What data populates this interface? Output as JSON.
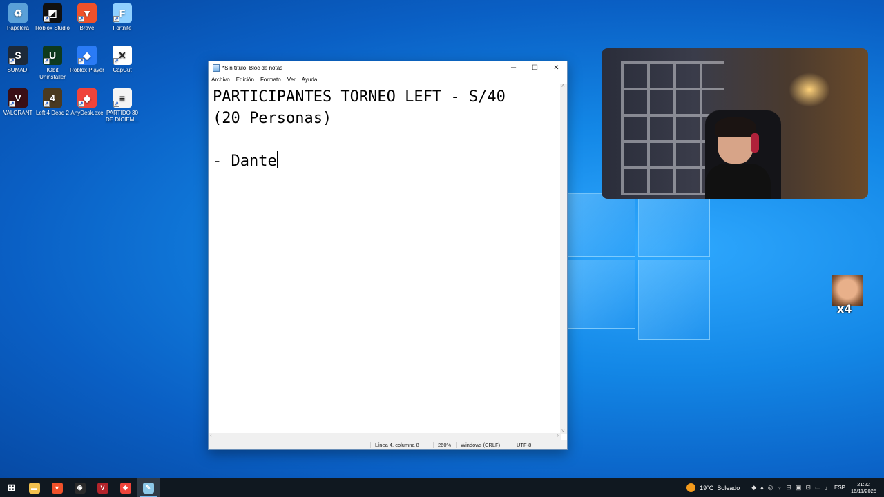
{
  "desktop": {
    "icons": [
      {
        "label": "Papelera",
        "icon": "recycle-bin-icon",
        "color": "#5aa0d8",
        "glyph": "♻"
      },
      {
        "label": "Roblox Studio",
        "icon": "roblox-studio-icon",
        "color": "#111111",
        "glyph": "◩"
      },
      {
        "label": "Brave",
        "icon": "brave-icon",
        "color": "#f0512a",
        "glyph": "▼"
      },
      {
        "label": "Fortnite",
        "icon": "fortnite-icon",
        "color": "#8fd0ff",
        "glyph": "F"
      },
      {
        "label": "SUMADI",
        "icon": "sumadi-icon",
        "color": "#1d2a3a",
        "glyph": "S"
      },
      {
        "label": "IObit Uninstaller",
        "icon": "iobit-uninstaller-icon",
        "color": "#0e3a1e",
        "glyph": "U"
      },
      {
        "label": "Roblox Player",
        "icon": "roblox-player-icon",
        "color": "#2a7bf6",
        "glyph": "◆"
      },
      {
        "label": "CapCut",
        "icon": "capcut-icon",
        "color": "#ffffff",
        "glyph": "✕"
      },
      {
        "label": "VALORANT",
        "icon": "valorant-icon",
        "color": "#3a0f16",
        "glyph": "V"
      },
      {
        "label": "Left 4 Dead 2",
        "icon": "left4dead2-icon",
        "color": "#4a3a20",
        "glyph": "4"
      },
      {
        "label": "AnyDesk.exe",
        "icon": "anydesk-icon",
        "color": "#ef443b",
        "glyph": "◆"
      },
      {
        "label": "PARTIDO 30 DE DICIEM...",
        "icon": "text-file-icon",
        "color": "#f4f4f4",
        "glyph": "≡"
      }
    ]
  },
  "notepad": {
    "title": "*Sin título: Bloc de notas",
    "menu": [
      "Archivo",
      "Edición",
      "Formato",
      "Ver",
      "Ayuda"
    ],
    "content": {
      "line1": "PARTICIPANTES TORNEO LEFT - S/40",
      "line2": "(20 Personas)",
      "line3": "",
      "line4": "- Dante"
    },
    "status": {
      "position": "Línea 4, columna 8",
      "zoom": "260%",
      "line_ending": "Windows (CRLF)",
      "encoding": "UTF-8"
    }
  },
  "overlay": {
    "emote_count": "x4"
  },
  "taskbar": {
    "apps": [
      {
        "name": "start",
        "icon": "windows-start-icon",
        "color": "#ffffff",
        "glyph": "⊞"
      },
      {
        "name": "explorer",
        "icon": "file-explorer-icon",
        "color": "#f2c14e",
        "glyph": "▬"
      },
      {
        "name": "brave",
        "icon": "brave-icon",
        "color": "#f0512a",
        "glyph": "▼"
      },
      {
        "name": "obs",
        "icon": "obs-icon",
        "color": "#2b2b2b",
        "glyph": "◉"
      },
      {
        "name": "voicemeeter",
        "icon": "voicemeeter-icon",
        "color": "#b3242b",
        "glyph": "V"
      },
      {
        "name": "anydesk",
        "icon": "anydesk-icon",
        "color": "#ef443b",
        "glyph": "◆"
      },
      {
        "name": "notepad",
        "icon": "notepad-icon",
        "color": "#8cc8e8",
        "glyph": "✎"
      }
    ],
    "weather": "19°C  Soleado",
    "language": "ESP",
    "time": "21:22",
    "date": "16/11/2025"
  }
}
